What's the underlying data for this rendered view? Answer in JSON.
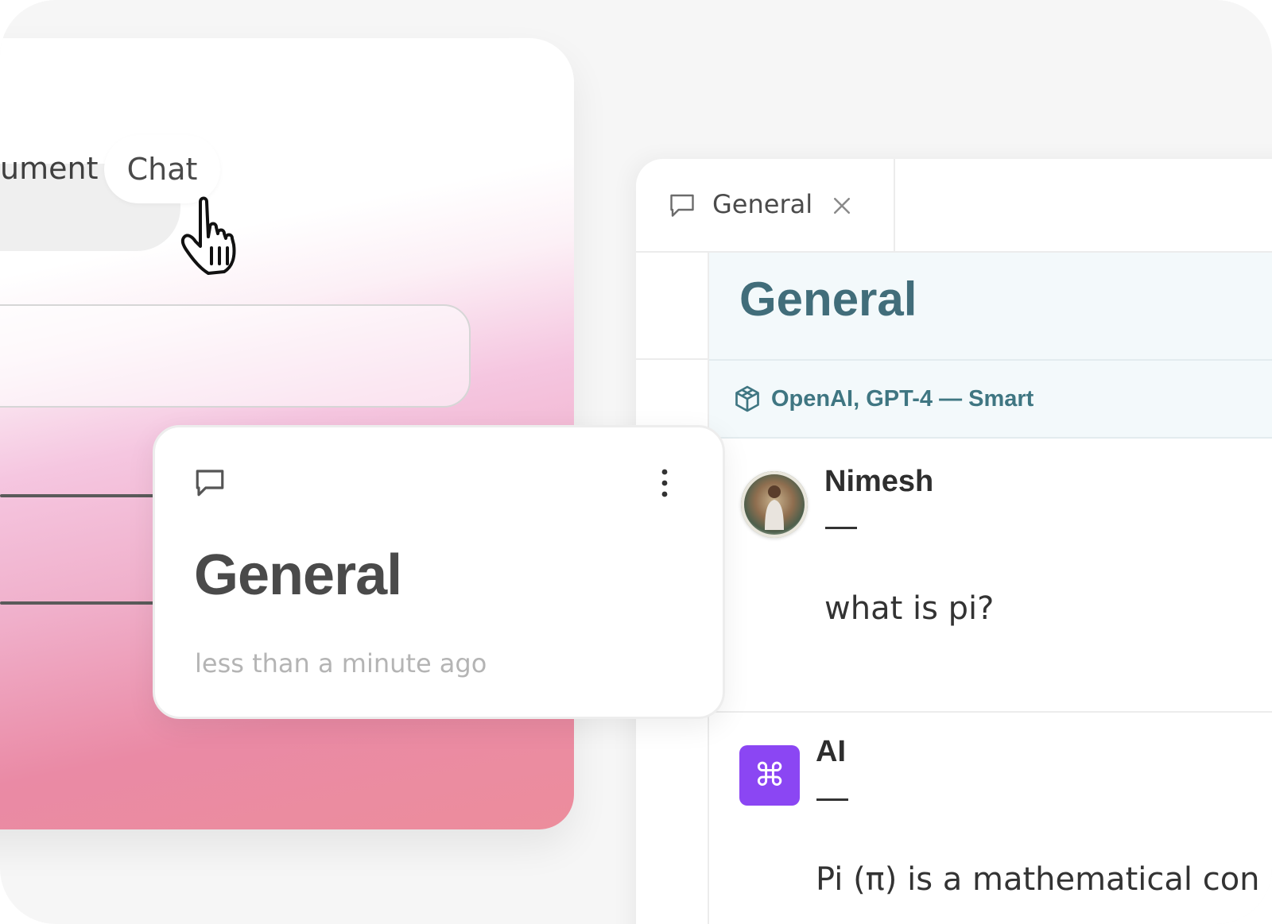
{
  "left_panel": {
    "segmented": {
      "document_label": "ument",
      "chat_label": "Chat"
    }
  },
  "chat_card": {
    "title": "General",
    "timestamp": "less than a minute ago"
  },
  "right_panel": {
    "tab": {
      "label": "General"
    },
    "header_title": "General",
    "model_label": "OpenAI, GPT-4 — Smart",
    "messages": [
      {
        "author": "Nimesh",
        "dash": "—",
        "text": "what is pi?"
      },
      {
        "author": "AI",
        "dash": "—",
        "badge": "⌘",
        "text": "Pi (π) is a mathematical con"
      }
    ]
  },
  "colors": {
    "ai_badge": "#8b46f3",
    "header_bg": "#f3f9fb",
    "header_title": "#416d7a",
    "model_label": "#3f7682"
  },
  "icons": [
    "hand-pointer-cursor-icon",
    "chat-bubble-icon",
    "more-vertical-icon",
    "close-icon",
    "cube-icon",
    "command-icon"
  ]
}
